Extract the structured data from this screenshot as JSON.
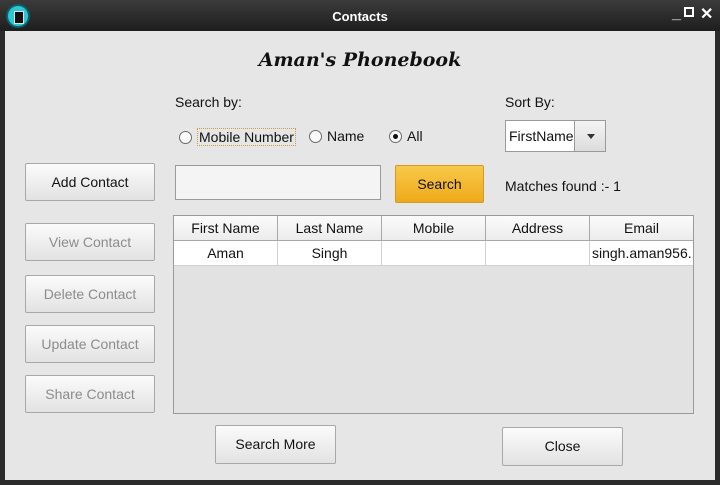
{
  "window": {
    "title": "Contacts"
  },
  "heading": "Aman's Phonebook",
  "search_by": {
    "label": "Search by:",
    "options": [
      "Mobile Number",
      "Name",
      "All"
    ],
    "selected": "All"
  },
  "sort_by": {
    "label": "Sort By:",
    "value": "FirstName"
  },
  "search": {
    "value": "",
    "button": "Search",
    "matches": "Matches found :- 1"
  },
  "side_buttons": {
    "add": "Add Contact",
    "view": "View Contact",
    "delete": "Delete Contact",
    "update": "Update Contact",
    "share": "Share Contact"
  },
  "table": {
    "columns": [
      "First Name",
      "Last Name",
      "Mobile",
      "Address",
      "Email"
    ],
    "rows": [
      [
        "Aman",
        "Singh",
        "",
        "",
        "singh.aman956..."
      ]
    ]
  },
  "bottom_buttons": {
    "search_more": "Search More",
    "close": "Close"
  }
}
